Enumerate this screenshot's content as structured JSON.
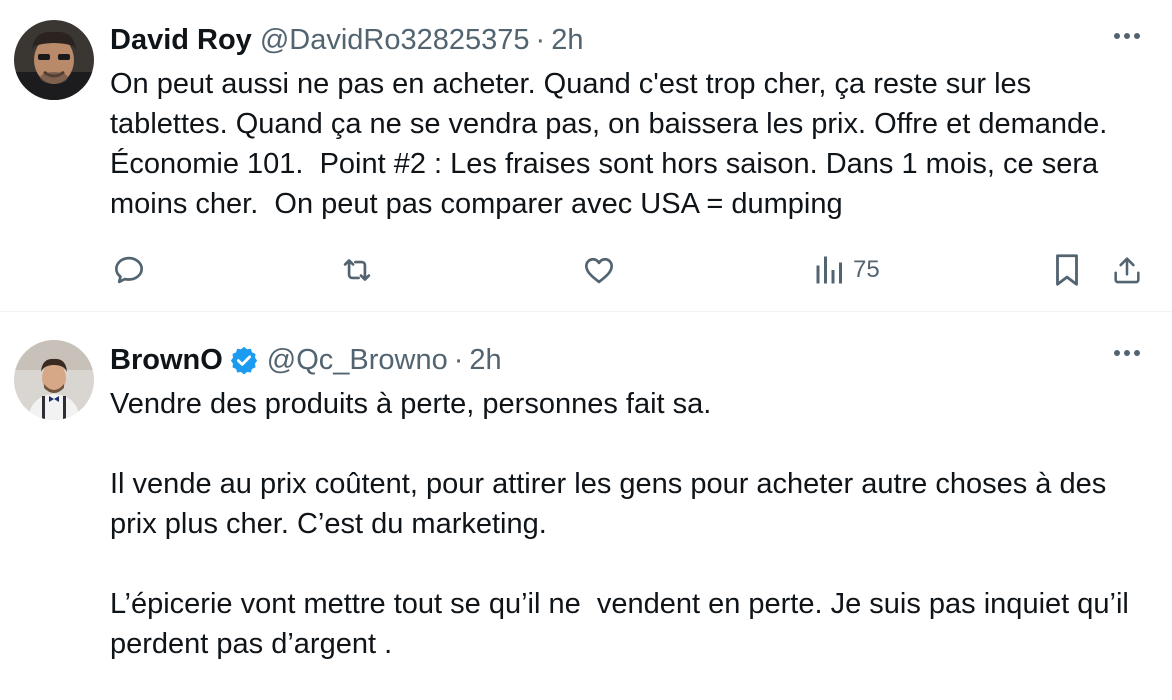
{
  "tweets": [
    {
      "display_name": "David Roy",
      "handle": "@DavidRo32825375",
      "separator": "·",
      "time": "2h",
      "verified": false,
      "text": "On peut aussi ne pas en acheter. Quand c'est trop cher, ça reste sur les tablettes. Quand ça ne se vendra pas, on baissera les prix. Offre et demande. Économie 101.  Point #2 : Les fraises sont hors saison. Dans 1 mois, ce sera moins cher.  On peut pas comparer avec USA = dumping",
      "actions": {
        "reply_icon": "reply-icon",
        "retweet_icon": "retweet-icon",
        "like_icon": "like-icon",
        "views_icon": "views-icon",
        "views_count": "75",
        "bookmark_icon": "bookmark-icon",
        "share_icon": "share-icon"
      }
    },
    {
      "display_name": "BrownO",
      "handle": "@Qc_Browno",
      "separator": "·",
      "time": "2h",
      "verified": true,
      "text": "Vendre des produits à perte, personnes fait sa.\n\nIl vende au prix coûtent, pour attirer les gens pour acheter autre choses à des prix plus cher. C’est du marketing.\n\nL’épicerie vont mettre tout se qu’il ne  vendent en perte. Je suis pas inquiet qu’il perdent pas d’argent ."
    }
  ],
  "colors": {
    "text_primary": "#0f1419",
    "text_secondary": "#536471",
    "verified_blue": "#1d9bf0",
    "divider": "#eff3f4"
  }
}
